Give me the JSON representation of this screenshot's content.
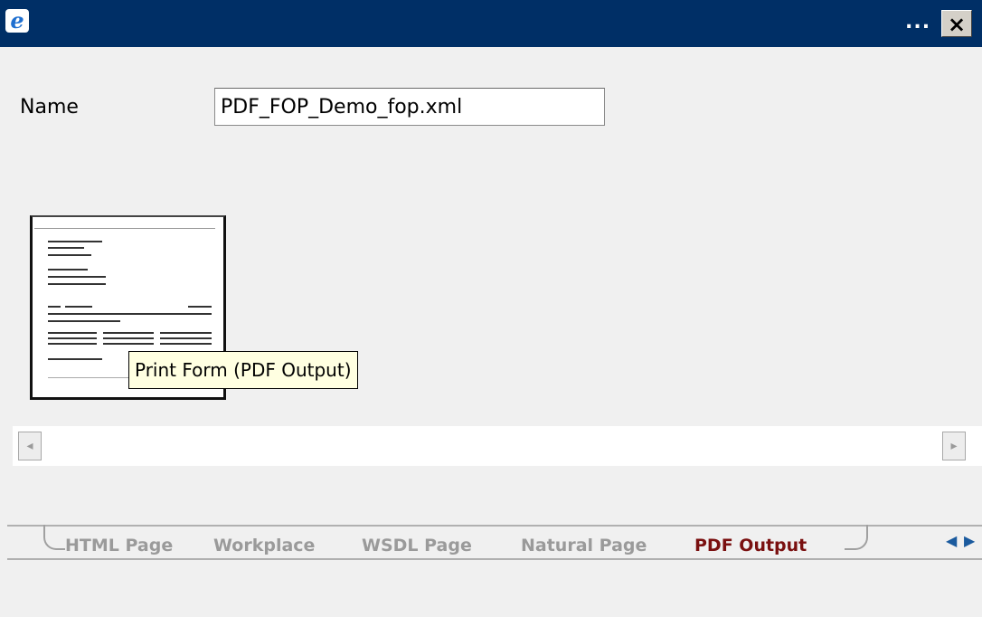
{
  "titlebar": {
    "icon": "ie-icon",
    "dots": "...",
    "close_label": "×"
  },
  "form": {
    "name_label": "Name",
    "name_value": "PDF_FOP_Demo_fop.xml"
  },
  "thumbnail": {
    "icon": "document-preview-icon",
    "tooltip": "Print Form (PDF Output)"
  },
  "scrollbar": {
    "left_arrow": "◂",
    "right_arrow": "▸"
  },
  "tabs": [
    {
      "label": "HTML Page",
      "active": false
    },
    {
      "label": "Workplace",
      "active": false
    },
    {
      "label": "WSDL Page",
      "active": false
    },
    {
      "label": "Natural Page",
      "active": false
    },
    {
      "label": "PDF Output",
      "active": true
    }
  ],
  "tab_nav": {
    "prev": "◀",
    "next": "▶"
  },
  "colors": {
    "titlebar": "#002f66",
    "active_tab": "#7a1010",
    "inactive_tab": "#9a9a9a",
    "tooltip_bg": "#ffffe1"
  }
}
